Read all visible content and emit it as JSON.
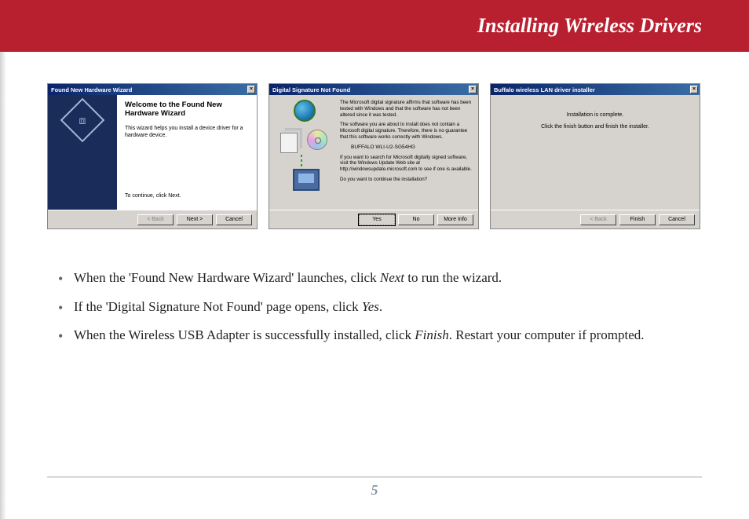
{
  "header": {
    "title": "Installing Wireless Drivers"
  },
  "dialogs": {
    "d1": {
      "title": "Found New Hardware Wizard",
      "heading": "Welcome to the Found New Hardware Wizard",
      "text": "This wizard helps you install a device driver for a hardware device.",
      "continue": "To continue, click Next.",
      "btn_back": "< Back",
      "btn_next": "Next >",
      "btn_cancel": "Cancel"
    },
    "d2": {
      "title": "Digital Signature Not Found",
      "p1": "The Microsoft digital signature affirms that software has been tested with Windows and that the software has not been altered since it was tested.",
      "p2": "The software you are about to install does not contain a Microsoft digital signature. Therefore, there is no guarantee that this software works correctly with Windows.",
      "device": "BUFFALO WLI-U2-SG54HG",
      "p3": "If you want to search for Microsoft digitally signed software, visit the Windows Update Web site at http://windowsupdate.microsoft.com to see if one is available.",
      "p4": "Do you want to continue the installation?",
      "btn_yes": "Yes",
      "btn_no": "No",
      "btn_more": "More Info"
    },
    "d3": {
      "title": "Buffalo wireless LAN driver installer",
      "line1": "Installation is complete.",
      "line2": "Click the finish button and finish the installer.",
      "btn_back": "< Back",
      "btn_finish": "Finish",
      "btn_cancel": "Cancel"
    }
  },
  "instructions": {
    "i1a": "When the 'Found New Hardware Wizard' launches, click ",
    "i1b": "Next",
    "i1c": " to run the wizard.",
    "i2a": "If the 'Digital Signature Not Found' page opens, click ",
    "i2b": "Yes",
    "i2c": ".",
    "i3a": "When the Wireless USB Adapter is successfully installed, click ",
    "i3b": "Finish",
    "i3c": ". Restart your computer if prompted."
  },
  "page_number": "5"
}
